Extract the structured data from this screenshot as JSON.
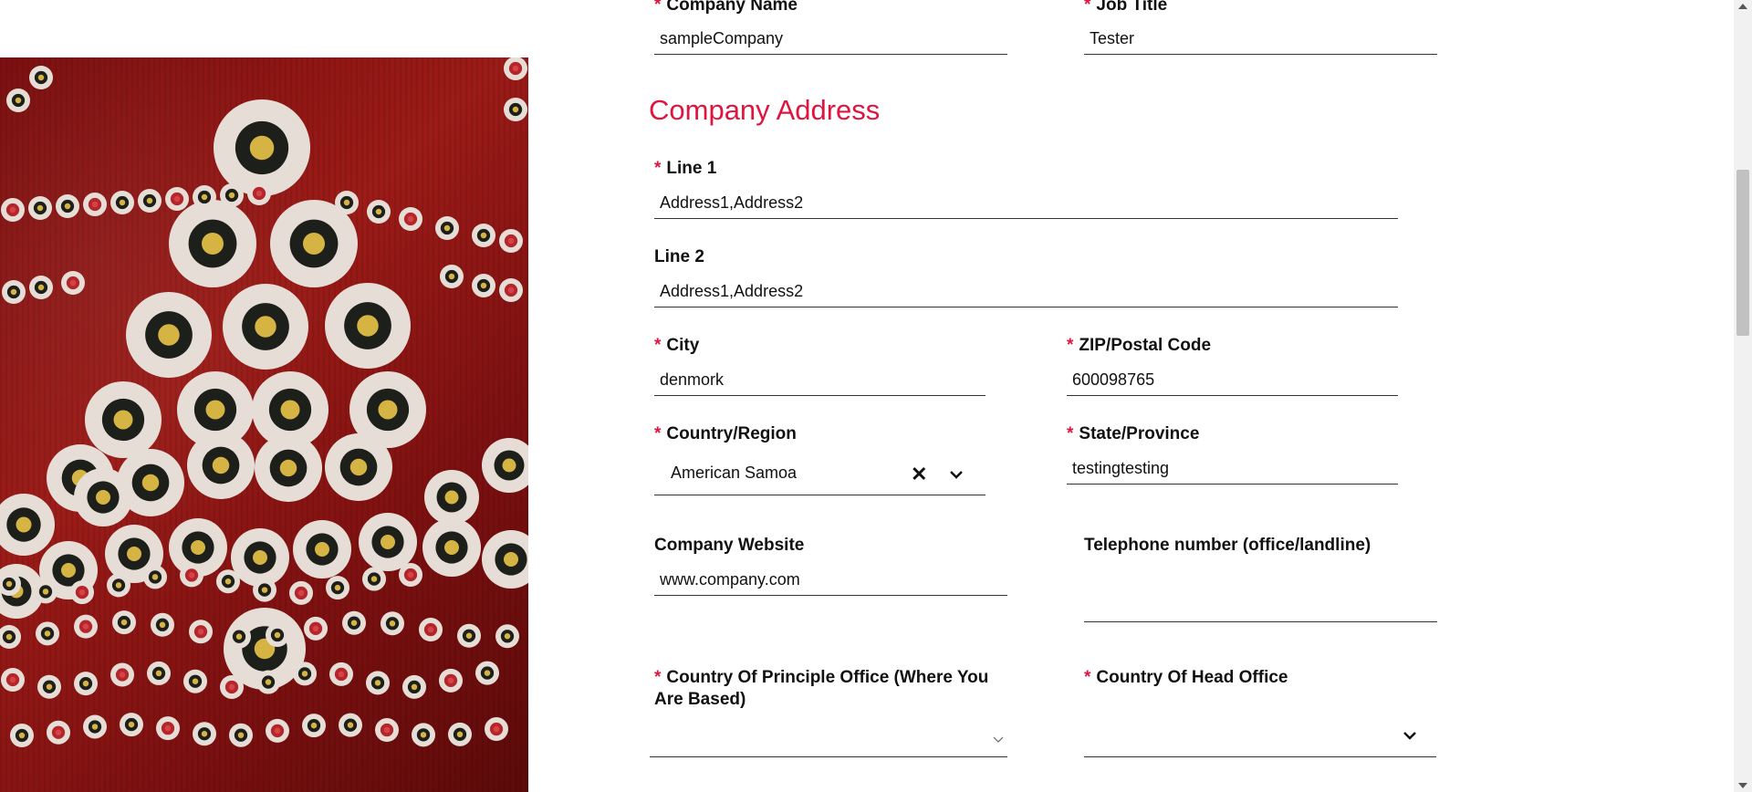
{
  "company_name": {
    "label": "Company Name",
    "value": "sampleCompany"
  },
  "job_title": {
    "label": "Job Title",
    "value": "Tester"
  },
  "section_title": "Company Address",
  "line1": {
    "label": "Line 1",
    "value": "Address1,Address2"
  },
  "line2": {
    "label": "Line 2",
    "value": "Address1,Address2"
  },
  "city": {
    "label": "City",
    "value": "denmork"
  },
  "zip": {
    "label": "ZIP/Postal Code",
    "value": "600098765"
  },
  "country_region": {
    "label": "Country/Region",
    "value": "American Samoa",
    "clear_icon": "close-icon",
    "dropdown_icon": "chevron-down-icon"
  },
  "state": {
    "label": "State/Province",
    "value": "testingtesting"
  },
  "website": {
    "label": "Company Website",
    "value": "www.company.com"
  },
  "telephone": {
    "label": "Telephone number (office/landline)",
    "value": ""
  },
  "principle_office": {
    "label": "Country Of Principle Office (Where You Are Based)",
    "value": ""
  },
  "head_office": {
    "label": "Country Of Head Office",
    "value": ""
  },
  "required_marker": "*",
  "colors": {
    "accent": "#e0153f",
    "hero_base": "#8b1414"
  }
}
